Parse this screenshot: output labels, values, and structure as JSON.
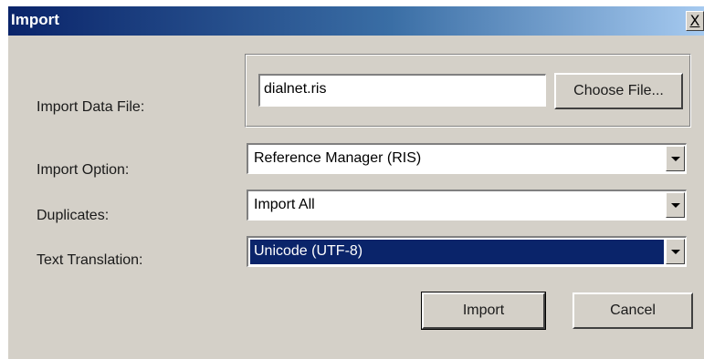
{
  "window": {
    "title": "Import",
    "close_label": "X"
  },
  "file": {
    "label": "Import Data File:",
    "value": "dialnet.ris",
    "choose_label": "Choose File..."
  },
  "import_option": {
    "label": "Import Option:",
    "value": "Reference Manager (RIS)"
  },
  "duplicates": {
    "label": "Duplicates:",
    "value": "Import All"
  },
  "text_translation": {
    "label": "Text Translation:",
    "value": "Unicode (UTF-8)"
  },
  "actions": {
    "import_label": "Import",
    "cancel_label": "Cancel"
  },
  "colors": {
    "titlebar_start": "#0a246a",
    "titlebar_end": "#a6caf0",
    "dialog_bg": "#d4d0c8",
    "selection_bg": "#0a246a"
  }
}
